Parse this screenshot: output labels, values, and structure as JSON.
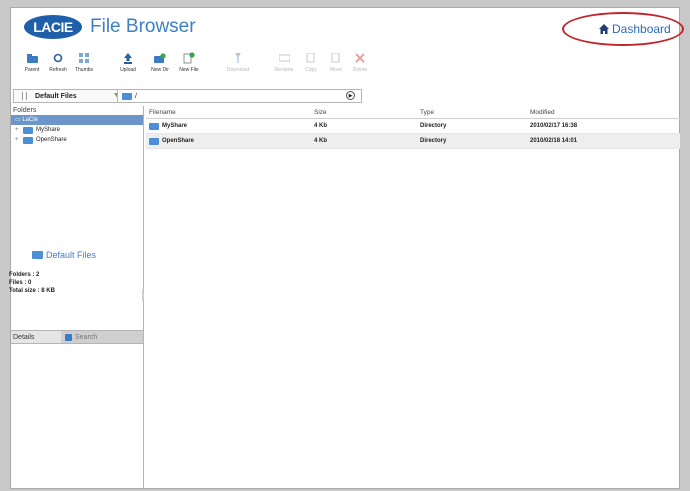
{
  "header": {
    "logo_text": "LACIE",
    "app_title": "File Browser",
    "dashboard_link": "Dashboard"
  },
  "toolbar": {
    "buttons": [
      {
        "label": "Parent",
        "icon": "parent-folder-icon",
        "enabled": true
      },
      {
        "label": "Refresh",
        "icon": "refresh-icon",
        "enabled": true
      },
      {
        "label": "Thumbs",
        "icon": "thumbnails-icon",
        "enabled": true
      },
      {
        "label": "Upload",
        "icon": "upload-icon",
        "enabled": true
      },
      {
        "label": "New Dir",
        "icon": "new-folder-icon",
        "enabled": true
      },
      {
        "label": "New File",
        "icon": "new-file-icon",
        "enabled": true
      },
      {
        "label": "Download",
        "icon": "download-icon",
        "enabled": false
      },
      {
        "label": "Rename",
        "icon": "rename-icon",
        "enabled": false
      },
      {
        "label": "Copy",
        "icon": "copy-icon",
        "enabled": false
      },
      {
        "label": "Move",
        "icon": "move-icon",
        "enabled": false
      },
      {
        "label": "Delete",
        "icon": "delete-icon",
        "enabled": false
      }
    ]
  },
  "location": {
    "share_select": "Default Files",
    "path": "/"
  },
  "folders_panel": {
    "title": "Folders",
    "root": "LaCie",
    "items": [
      "MyShare",
      "OpenShare"
    ]
  },
  "details_panel": {
    "details_tab": "Details",
    "search_tab": "Search",
    "title": "Default Files",
    "stats": [
      "Folders : 2",
      "Files : 0",
      "Total size : 8 KB"
    ]
  },
  "file_list": {
    "columns": [
      "Filename",
      "Size",
      "Type",
      "Modified"
    ],
    "rows": [
      {
        "name": "MyShare",
        "size": "4 Kb",
        "type": "Directory",
        "modified": "2010/02/17 16:38"
      },
      {
        "name": "OpenShare",
        "size": "4 Kb",
        "type": "Directory",
        "modified": "2010/02/18 14:01"
      }
    ]
  },
  "colors": {
    "accent": "#3d7fc9",
    "logo_bg": "#1f5ea8",
    "annotation": "#c1272d",
    "tree_selected": "#6b96c9"
  }
}
